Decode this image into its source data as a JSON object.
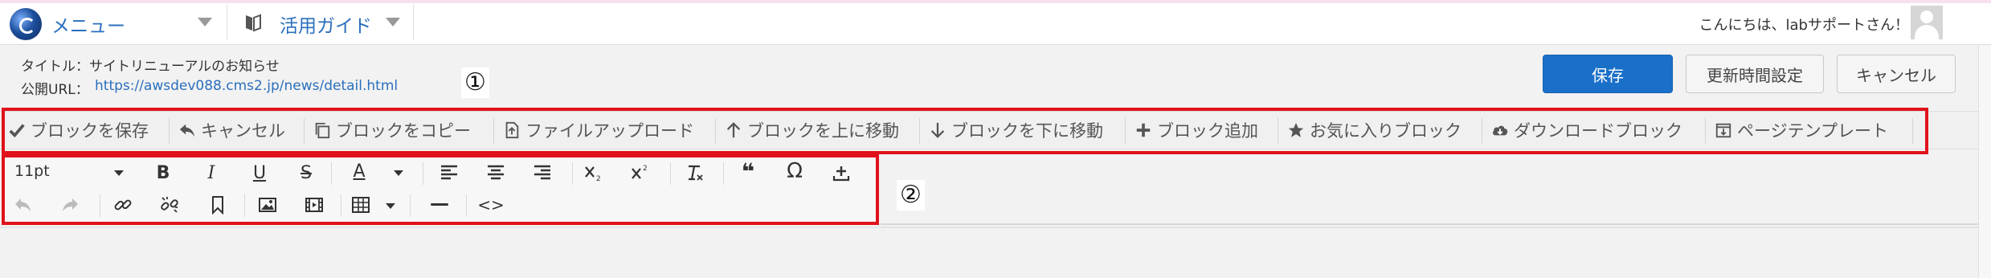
{
  "header": {
    "menu_label": "メニュー",
    "guide_label": "活用ガイド",
    "greeting": "こんにちは、labサポートさん！"
  },
  "page_info": {
    "title": "タイトル：サイトリニューアルのお知らせ",
    "url_label": "公開URL：",
    "url": "https://awsdev088.cms2.jp/news/detail.html"
  },
  "markers": {
    "one": "①",
    "two": "②"
  },
  "actions": {
    "save": "保存",
    "update_time": "更新時間設定",
    "cancel": "キャンセル"
  },
  "block_toolbar": {
    "items": [
      {
        "label": "ブロックを保存",
        "icon": "check-icon"
      },
      {
        "label": "キャンセル",
        "icon": "undo-arrow-icon"
      },
      {
        "label": "ブロックをコピー",
        "icon": "copy-icon"
      },
      {
        "label": "ファイルアップロード",
        "icon": "file-upload-icon"
      },
      {
        "label": "ブロックを上に移動",
        "icon": "arrow-up-icon"
      },
      {
        "label": "ブロックを下に移動",
        "icon": "arrow-down-icon"
      },
      {
        "label": "ブロック追加",
        "icon": "plus-icon"
      },
      {
        "label": "お気に入りブロック",
        "icon": "star-icon"
      },
      {
        "label": "ダウンロードブロック",
        "icon": "cloud-download-icon"
      },
      {
        "label": "ページテンプレート",
        "icon": "template-download-icon"
      }
    ]
  },
  "editor_toolbar": {
    "font_size": "11pt",
    "text_color_glyph": "A",
    "bold_glyph": "B",
    "italic_glyph": "I",
    "underline_glyph": "U",
    "strike_glyph": "S",
    "omega_glyph": "Ω",
    "quote_glyph": "❝",
    "code_glyph": "<>",
    "hr_glyph": "—"
  }
}
